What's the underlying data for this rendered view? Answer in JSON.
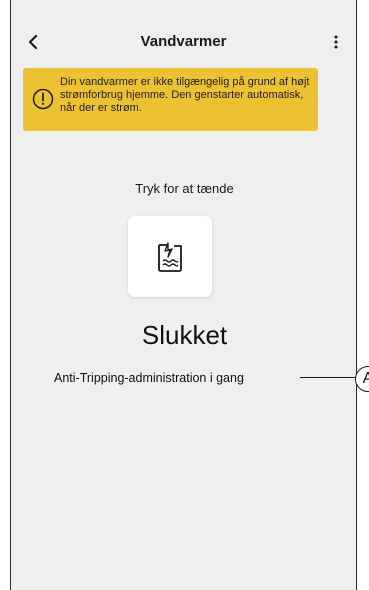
{
  "header": {
    "title": "Vandvarmer",
    "back_icon": "chevron-left-icon",
    "menu_icon": "more-vertical-icon"
  },
  "banner": {
    "icon": "warning-circle-icon",
    "color": "#ecc232",
    "text": "Din vandvarmer er ikke tilgængelig på grund af højt strømforbrug hjemme. Den genstarter automatisk, når der er strøm."
  },
  "device": {
    "tap_label": "Tryk for at tænde",
    "icon": "water-heater-fault-icon",
    "status": "Slukket",
    "subtitle": "Anti-Tripping-administration i gang"
  },
  "callout": {
    "label": "A"
  }
}
